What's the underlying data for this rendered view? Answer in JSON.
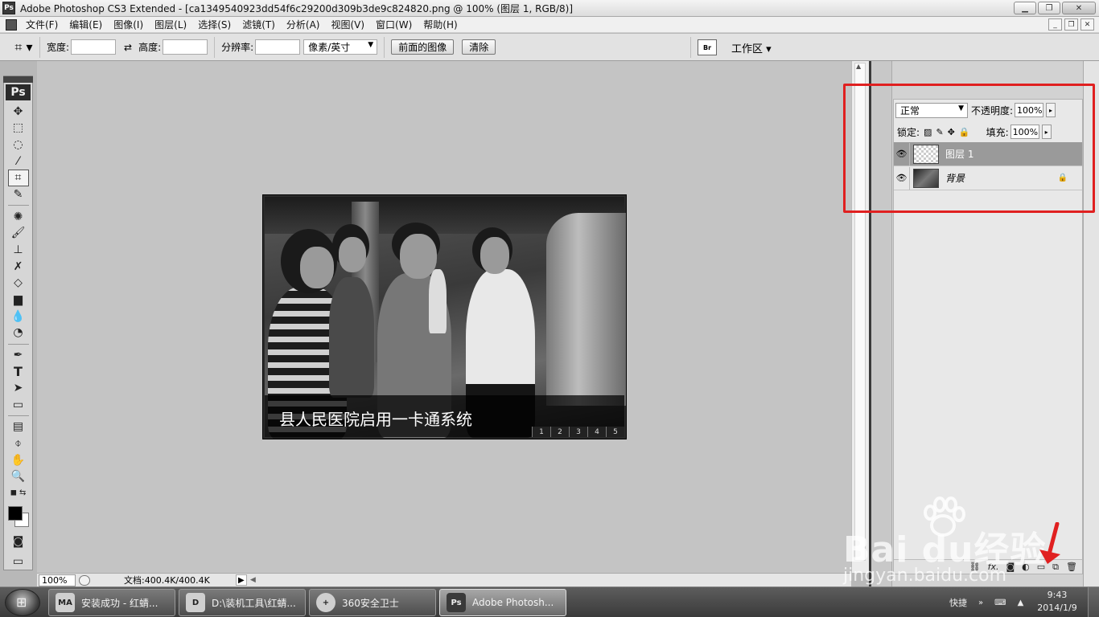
{
  "window": {
    "title": "Adobe Photoshop CS3 Extended - [ca1349540923dd54f6c29200d309b3de9c824820.png @ 100% (图层 1, RGB/8)]",
    "app_badge": "Ps"
  },
  "menu": {
    "items": [
      "文件(F)",
      "编辑(E)",
      "图像(I)",
      "图层(L)",
      "选择(S)",
      "滤镜(T)",
      "分析(A)",
      "视图(V)",
      "窗口(W)",
      "帮助(H)"
    ]
  },
  "options": {
    "width_label": "宽度:",
    "height_label": "高度:",
    "resolution_label": "分辨率:",
    "unit_value": "像素/英寸",
    "front_image_btn": "前面的图像",
    "clear_btn": "清除",
    "bridge_label": "Br",
    "workspace_label": "工作区 ▾"
  },
  "toolbox": {
    "badge": "Ps"
  },
  "canvas": {
    "caption": "县人民医院启用一卡通系统",
    "pager": [
      "1",
      "2",
      "3",
      "4",
      "5"
    ]
  },
  "status": {
    "zoom": "100%",
    "doc_size": "文档:400.4K/400.4K"
  },
  "layers": {
    "blend_mode": "正常",
    "opacity_label": "不透明度:",
    "opacity_value": "100%",
    "lock_label": "锁定:",
    "fill_label": "填充:",
    "fill_value": "100%",
    "rows": [
      {
        "name": "图层 1",
        "selected": true
      },
      {
        "name": "背景",
        "selected": false
      }
    ],
    "bottom_icons": [
      "link-icon",
      "fx-icon",
      "mask-icon",
      "adjustment-icon",
      "group-icon",
      "new-layer-icon",
      "trash-icon"
    ]
  },
  "watermark": {
    "text": "Bai du经验",
    "url": "jingyan.baidu.com"
  },
  "taskbar": {
    "tasks": [
      {
        "label": "安装成功 - 红蜻...",
        "icon": "MA"
      },
      {
        "label": "D:\\装机工具\\红蜻...",
        "icon": "D"
      },
      {
        "label": "360安全卫士",
        "icon": "+"
      },
      {
        "label": "Adobe Photosh...",
        "icon": "Ps"
      }
    ],
    "tray_label": "快捷",
    "time": "9:43",
    "date": "2014/1/9"
  },
  "colors": {
    "highlight": "#e02020",
    "selected_layer": "#9a9a9a"
  }
}
